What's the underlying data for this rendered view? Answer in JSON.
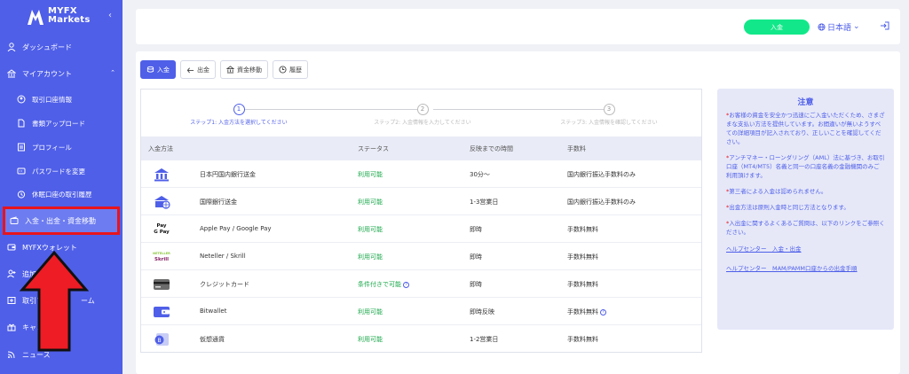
{
  "brand": {
    "name_line1": "MYFX",
    "name_line2": "Markets"
  },
  "sidebar": {
    "collapse_glyph": "‹",
    "items": [
      {
        "label": "ダッシュボード",
        "icon": "person-icon"
      },
      {
        "label": "マイアカウント",
        "icon": "bank-icon",
        "chevron": "⌃"
      },
      {
        "label": "取引口座情報",
        "icon": "account-icon"
      },
      {
        "label": "書類アップロード",
        "icon": "document-icon"
      },
      {
        "label": "プロフィール",
        "icon": "profile-icon"
      },
      {
        "label": "パスワードを変更",
        "icon": "password-icon"
      },
      {
        "label": "休眠口座の取引履歴",
        "icon": "clock-icon"
      },
      {
        "label": "入金・出金・資金移動",
        "icon": "wallet-icon"
      },
      {
        "label": "MYFXウォレット",
        "icon": "wallet-card-icon"
      },
      {
        "label": "追加",
        "icon": "user-plus-icon"
      },
      {
        "label": "取引プラ",
        "label_tail": "ーム",
        "icon": "platform-icon"
      },
      {
        "label": "キャンペ",
        "icon": "gift-icon"
      },
      {
        "label": "ニュース",
        "icon": "rss-icon"
      }
    ]
  },
  "header": {
    "deposit_label": "入金",
    "language_label": "日本語",
    "language_chevron": "⌄"
  },
  "tabs": [
    {
      "label": "入金",
      "icon": "deposit-icon"
    },
    {
      "label": "出金",
      "icon": "withdraw-icon"
    },
    {
      "label": "資金移動",
      "icon": "transfer-icon"
    },
    {
      "label": "履歴",
      "icon": "history-icon"
    }
  ],
  "steps": [
    {
      "number": "1",
      "label": "ステップ1: 入金方法を選択してください"
    },
    {
      "number": "2",
      "label": "ステップ2: 入金情報を入力してください"
    },
    {
      "number": "3",
      "label": "ステップ3: 入金情報を確認してください"
    }
  ],
  "table": {
    "headers": [
      "入金方法",
      "ステータス",
      "反映までの時間",
      "手数料"
    ],
    "rows": [
      {
        "method": "日本円国内銀行送金",
        "status": "利用可能",
        "time": "30分〜",
        "fee": "国内銀行振込手数料のみ",
        "icon": "bank-icon"
      },
      {
        "method": "国際銀行送金",
        "status": "利用可能",
        "time": "1-3営業日",
        "fee": "国内銀行振込手数料のみ",
        "icon": "international-bank-icon"
      },
      {
        "method": "Apple Pay / Google Pay",
        "status": "利用可能",
        "time": "即時",
        "fee": "手数料無料",
        "icon": "apple-google-pay-icon",
        "logo_top": "Pay",
        "logo_bottom": "G Pay"
      },
      {
        "method": "Neteller / Skrill",
        "status": "利用可能",
        "time": "即時",
        "fee": "手数料無料",
        "icon": "neteller-skrill-icon",
        "logo_top": "NETELLER",
        "logo_bottom": "Skrill"
      },
      {
        "method": "クレジットカード",
        "status": "条件付きで可能",
        "time": "即時",
        "fee": "手数料無料",
        "icon": "credit-card-icon",
        "status_help": "?"
      },
      {
        "method": "Bitwallet",
        "status": "利用可能",
        "time": "即時反映",
        "fee": "手数料無料",
        "icon": "bitwallet-icon",
        "fee_help": "?"
      },
      {
        "method": "仮想通貨",
        "status": "利用可能",
        "time": "1-2営業日",
        "fee": "手数料無料",
        "icon": "crypto-icon"
      }
    ]
  },
  "notice": {
    "title": "注意",
    "paragraphs": [
      "お客様の資金を安全かつ迅速にご入金いただくため、さまざまな支払い方法を提供しています。お間違いが無いようすべての詳細項目が記入されており、正しいことを確認してください。",
      "アンチマネー・ローンダリング（AML）法に基づき、お取引口座（MT4/MT5）名義と同一の口座名義の金融機関のみご利用頂けます。",
      "第三者による入金は認められません。",
      "出金方法は原則入金時と同じ方法となります。",
      "入出金に関するよくあるご質問は、以下のリンクをご参照ください。"
    ],
    "asterisk": "*",
    "links": [
      "ヘルプセンター　入金・出金",
      "ヘルプセンター　MAM/PAMM口座からの出金手順"
    ]
  },
  "colors": {
    "accent": "#4f5fe8",
    "success": "#12e889",
    "status_green": "#1aa84a",
    "highlight_red": "#e8141c"
  }
}
